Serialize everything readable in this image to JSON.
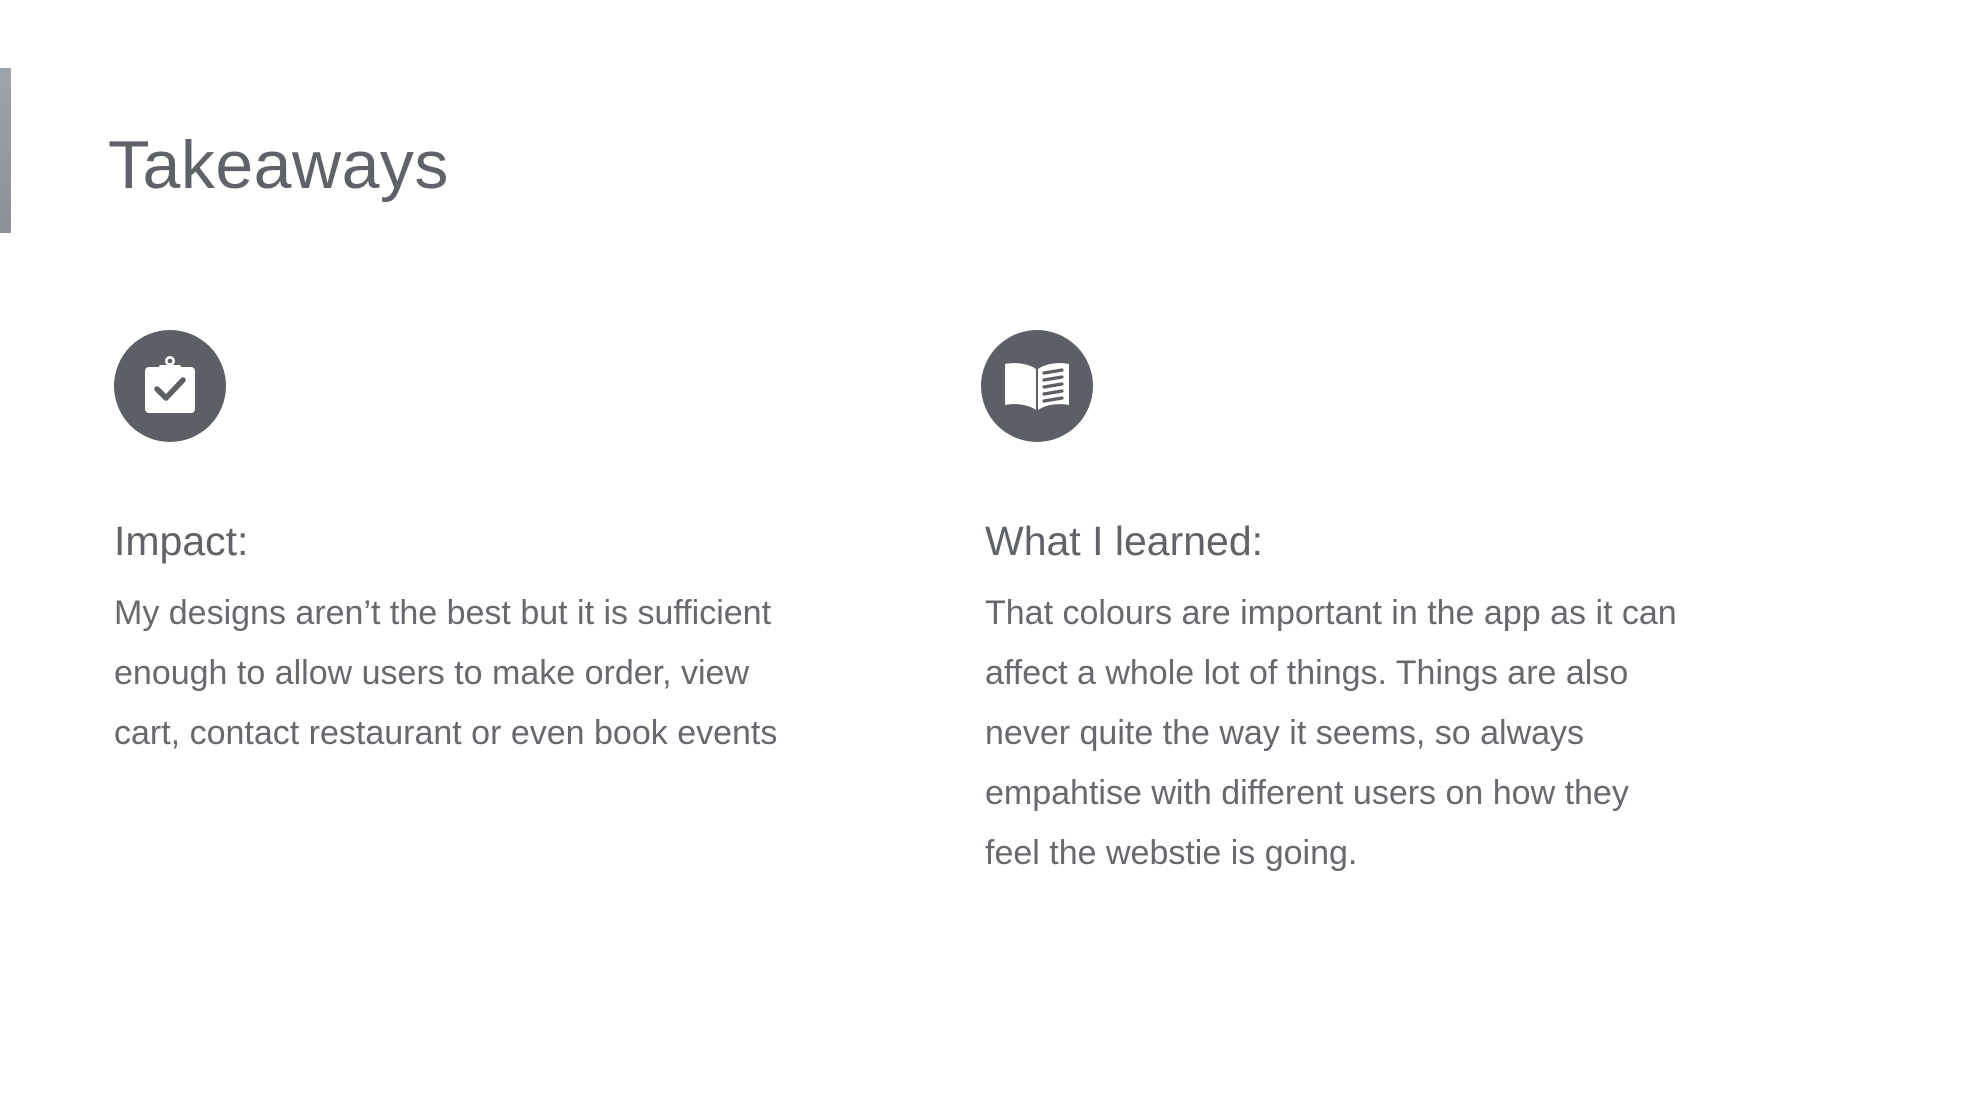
{
  "slide": {
    "title": "Takeaways",
    "accent_color": "#9fa3ab",
    "icon_background": "#5c5f65"
  },
  "columns": [
    {
      "icon": "clipboard-check-icon",
      "heading": "Impact:",
      "body": "My designs aren’t the best but it is sufficient\nenough to allow users to make order, view\ncart, contact restaurant or even book events"
    },
    {
      "icon": "open-book-icon",
      "heading": "What I learned:",
      "body": "That colours are important in the app as it can\naffect a whole lot of things. Things are also\nnever quite the way it seems, so always\nempahtise with different users on how they\nfeel the webstie is going."
    }
  ]
}
